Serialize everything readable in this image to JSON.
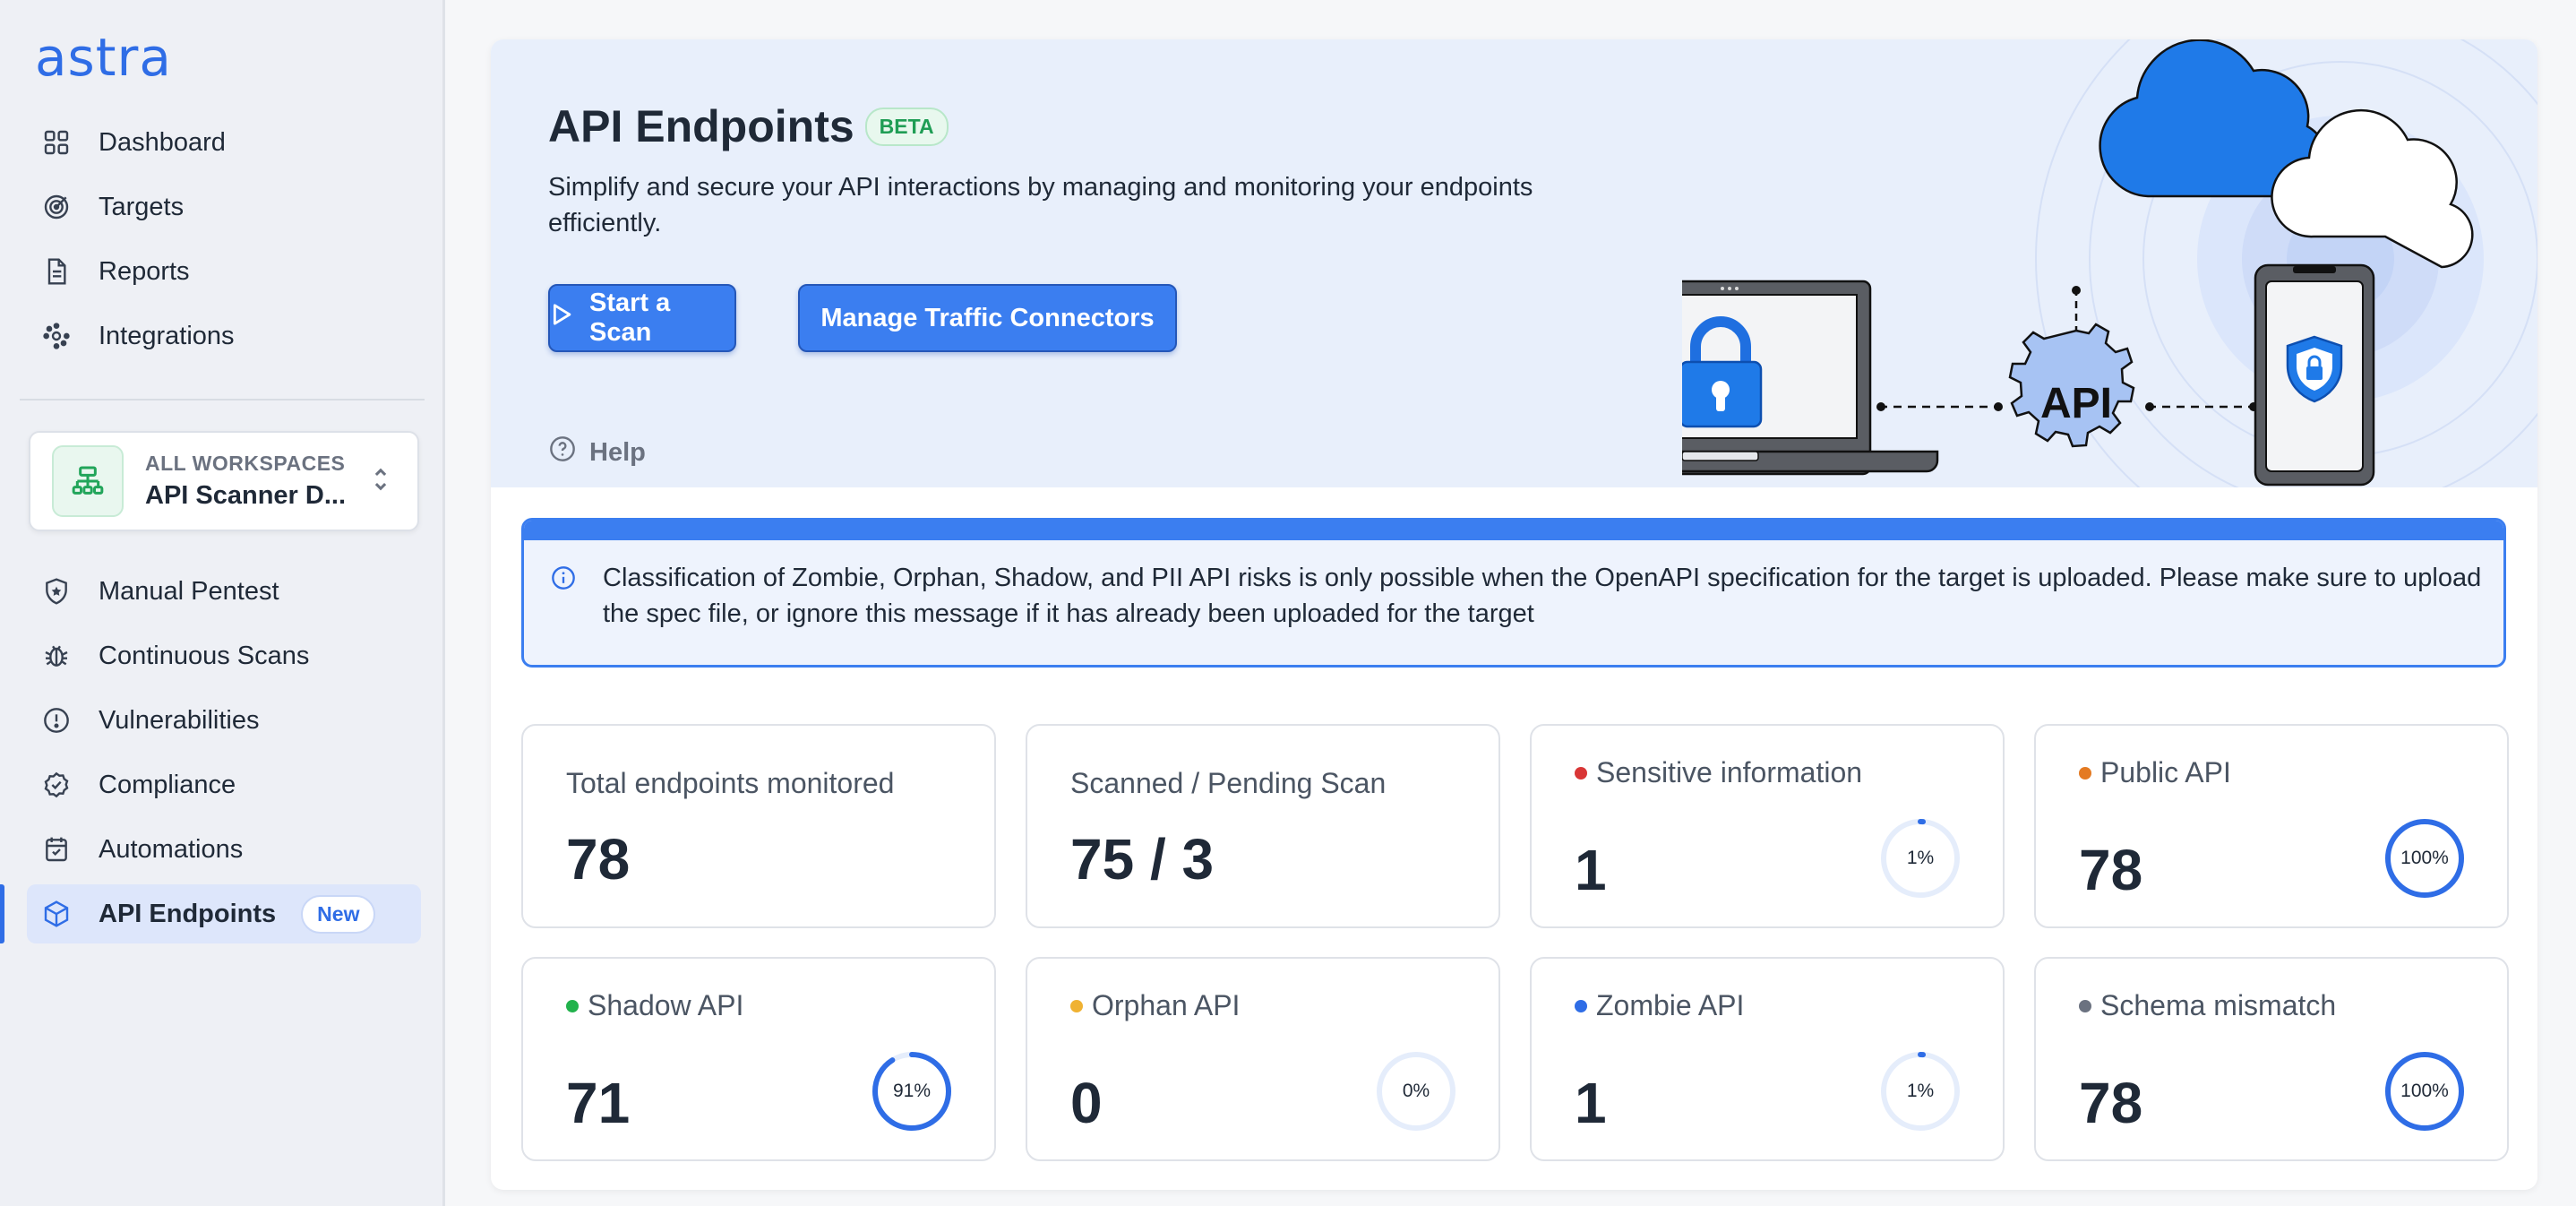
{
  "app": {
    "logo": "astra"
  },
  "sidebar": {
    "top_items": [
      {
        "label": "Dashboard",
        "icon": "grid-icon"
      },
      {
        "label": "Targets",
        "icon": "target-icon"
      },
      {
        "label": "Reports",
        "icon": "report-icon"
      },
      {
        "label": "Integrations",
        "icon": "integrations-icon"
      }
    ],
    "workspace": {
      "label": "ALL WORKSPACES",
      "name": "API Scanner D..."
    },
    "bottom_items": [
      {
        "label": "Manual Pentest",
        "icon": "shield-icon"
      },
      {
        "label": "Continuous Scans",
        "icon": "bug-icon"
      },
      {
        "label": "Vulnerabilities",
        "icon": "alert-icon"
      },
      {
        "label": "Compliance",
        "icon": "check-badge-icon"
      },
      {
        "label": "Automations",
        "icon": "calendar-icon"
      },
      {
        "label": "API Endpoints",
        "icon": "cube-icon",
        "badge": "New",
        "active": true
      }
    ]
  },
  "hero": {
    "title": "API Endpoints",
    "badge": "BETA",
    "description": "Simplify and secure your API interactions by managing and monitoring your endpoints efficiently.",
    "start_scan_label": "Start a Scan",
    "connectors_label": "Manage Traffic Connectors",
    "help_label": "Help",
    "illustration_text": "API"
  },
  "info_banner": {
    "text": "Classification of Zombie, Orphan, Shadow, and PII API risks is only possible when the OpenAPI specification for the target is uploaded. Please make sure to upload the spec file, or ignore this message if it has already been uploaded for the target"
  },
  "stats": {
    "total": {
      "label": "Total endpoints monitored",
      "value": "78"
    },
    "scanned": {
      "label": "Scanned / Pending Scan",
      "value": "75 / 3"
    },
    "sensitive": {
      "label": "Sensitive information",
      "value": "1",
      "percent": 1,
      "percent_label": "1%",
      "dot": "#d93636"
    },
    "public": {
      "label": "Public API",
      "value": "78",
      "percent": 100,
      "percent_label": "100%",
      "dot": "#e47a22"
    },
    "shadow": {
      "label": "Shadow API",
      "value": "71",
      "percent": 91,
      "percent_label": "91%",
      "dot": "#22b24c"
    },
    "orphan": {
      "label": "Orphan API",
      "value": "0",
      "percent": 0,
      "percent_label": "0%",
      "dot": "#f0b232"
    },
    "zombie": {
      "label": "Zombie API",
      "value": "1",
      "percent": 1,
      "percent_label": "1%",
      "dot": "#2f6de6"
    },
    "schema": {
      "label": "Schema mismatch",
      "value": "78",
      "percent": 100,
      "percent_label": "100%",
      "dot": "#6b7280"
    }
  },
  "colors": {
    "accent": "#3b7ef0",
    "ring_track": "#e5edfb",
    "ring_fill": "#2f6de6"
  }
}
